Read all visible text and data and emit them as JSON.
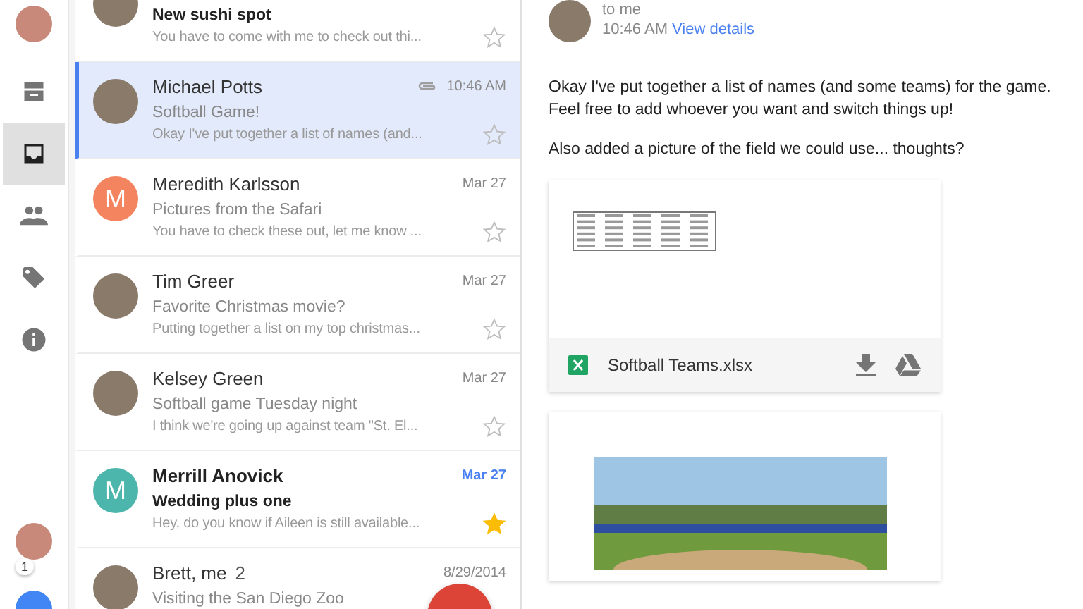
{
  "rail": {
    "items": [
      {
        "kind": "archive",
        "selected": false
      },
      {
        "kind": "inbox",
        "selected": true
      },
      {
        "kind": "people",
        "selected": false
      },
      {
        "kind": "tag",
        "selected": false
      },
      {
        "kind": "info",
        "selected": false
      }
    ],
    "badge": "1"
  },
  "messages": [
    {
      "subject": "New sushi spot",
      "snippet": "You have to come with me to check out thi...",
      "avatar": {
        "kind": "photo"
      },
      "unread": true,
      "selected": false,
      "starred": false,
      "attachment": false
    },
    {
      "sender": "Michael Potts",
      "subject": "Softball Game!",
      "snippet": "Okay I've put together a list of names (and...",
      "date": "10:46 AM",
      "avatar": {
        "kind": "photo"
      },
      "unread": false,
      "selected": true,
      "starred": false,
      "attachment": true
    },
    {
      "sender": "Meredith Karlsson",
      "subject": "Pictures from the Safari",
      "snippet": "You have to check these out, let me know ...",
      "date": "Mar 27",
      "avatar": {
        "kind": "letter",
        "letter": "M",
        "color": "#f4845f"
      },
      "unread": false,
      "selected": false,
      "starred": false,
      "attachment": false
    },
    {
      "sender": "Tim Greer",
      "subject": "Favorite Christmas movie?",
      "snippet": "Putting together a list on my top christmas...",
      "date": "Mar 27",
      "avatar": {
        "kind": "photo"
      },
      "unread": false,
      "selected": false,
      "starred": false,
      "attachment": false
    },
    {
      "sender": "Kelsey Green",
      "subject": "Softball game Tuesday night",
      "snippet": "I think we're going up against team \"St. El...",
      "date": "Mar 27",
      "avatar": {
        "kind": "photo"
      },
      "unread": false,
      "selected": false,
      "starred": false,
      "attachment": false
    },
    {
      "sender": "Merrill Anovick",
      "subject": "Wedding plus one",
      "snippet": "Hey, do you know if Aileen is still available...",
      "date": "Mar 27",
      "avatar": {
        "kind": "letter",
        "letter": "M",
        "color": "#4db6ac"
      },
      "unread": true,
      "selected": false,
      "starred": true,
      "attachment": false
    },
    {
      "sender": "Brett, me",
      "count": "2",
      "subject": "Visiting the San Diego Zoo",
      "date": "8/29/2014",
      "avatar": {
        "kind": "photo"
      },
      "unread": false,
      "selected": false
    }
  ],
  "detail": {
    "recipient": "to me",
    "time": "10:46 AM",
    "details_link": "View details",
    "body": [
      "Okay I've put together a list of names (and some teams) for the game. Feel free to add whoever you want and switch things up!",
      "Also added a picture of the field we could use... thoughts?"
    ],
    "attachments": [
      {
        "kind": "file",
        "name": "Softball Teams.xlsx"
      },
      {
        "kind": "image"
      }
    ]
  }
}
